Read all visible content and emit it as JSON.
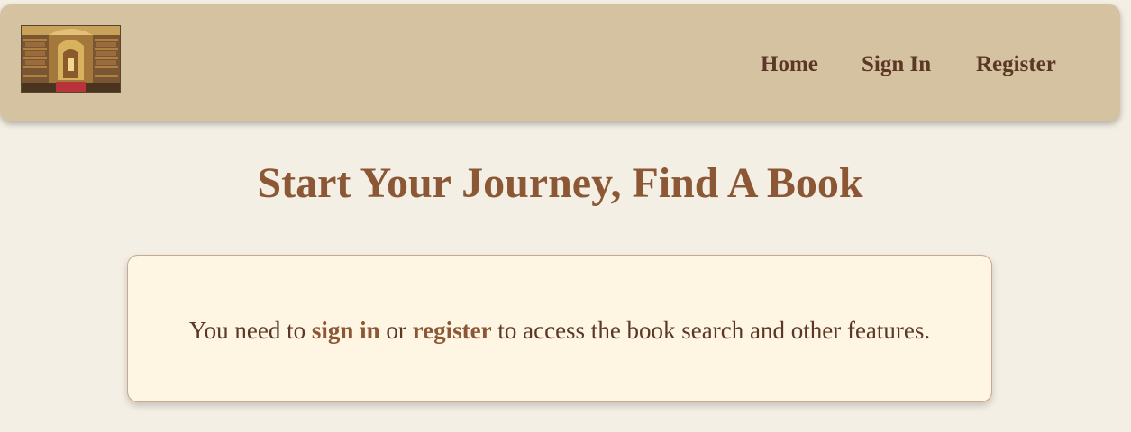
{
  "colors": {
    "page_background": "#f3efe4",
    "header_background": "#d5c2a0",
    "nav_link": "#5b3726",
    "title": "#8b5735",
    "card_background": "#fef5e2",
    "card_border": "#c7a891",
    "body_text": "#5b3726",
    "inline_link": "#8b5735"
  },
  "header": {
    "logo_alt": "Library logo",
    "logo_icon": "library-interior-logo",
    "nav": {
      "home": "Home",
      "sign_in": "Sign In",
      "register": "Register"
    }
  },
  "main": {
    "title": "Start Your Journey, Find A Book",
    "notice": {
      "prefix": "You need to ",
      "sign_in_link": "sign in",
      "middle": " or ",
      "register_link": "register",
      "suffix": " to access the book search and other features."
    }
  }
}
